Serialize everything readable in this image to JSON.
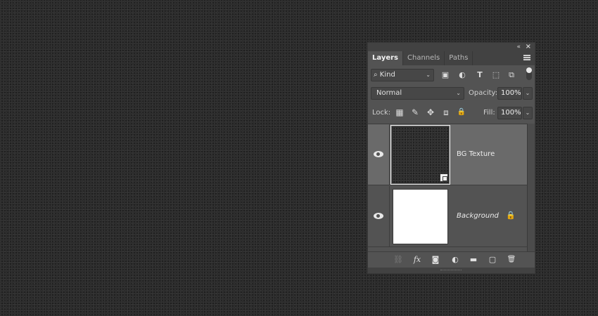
{
  "panel": {
    "tabs": [
      {
        "label": "Layers"
      },
      {
        "label": "Channels"
      },
      {
        "label": "Paths"
      }
    ],
    "icons": {
      "collapse": "«",
      "close": "×"
    }
  },
  "filter": {
    "kind_label": "Kind",
    "search_glyph": "⌕",
    "caret": "⌄",
    "icons": [
      "image-filter-icon",
      "adjustment-filter-icon",
      "type-filter-icon",
      "shape-filter-icon",
      "smart-object-filter-icon"
    ],
    "glyphs": {
      "image": "▣",
      "adjustment": "◐",
      "type": "T",
      "shape": "⬚",
      "smart": "⧉"
    }
  },
  "blend": {
    "mode": "Normal",
    "opacity_label": "Opacity:",
    "opacity_value": "100%",
    "lock_label": "Lock:",
    "fill_label": "Fill:",
    "fill_value": "100%",
    "caret": "⌄",
    "lock_glyphs": {
      "pixels": "▦",
      "paint": "✎",
      "position": "✥",
      "artboard": "⧈",
      "all": "🔒"
    }
  },
  "layers": [
    {
      "name": "BG Texture",
      "selected": true,
      "visible": true,
      "smart_object": true
    },
    {
      "name": "Background",
      "selected": false,
      "visible": true,
      "locked": true,
      "lock_glyph": "🔒"
    }
  ],
  "bottom": {
    "glyphs": {
      "link": "⛓",
      "fx": "fx",
      "mask": "◙",
      "adjustment": "◐",
      "group": "▬",
      "new": "▢",
      "delete": "🗑"
    }
  }
}
